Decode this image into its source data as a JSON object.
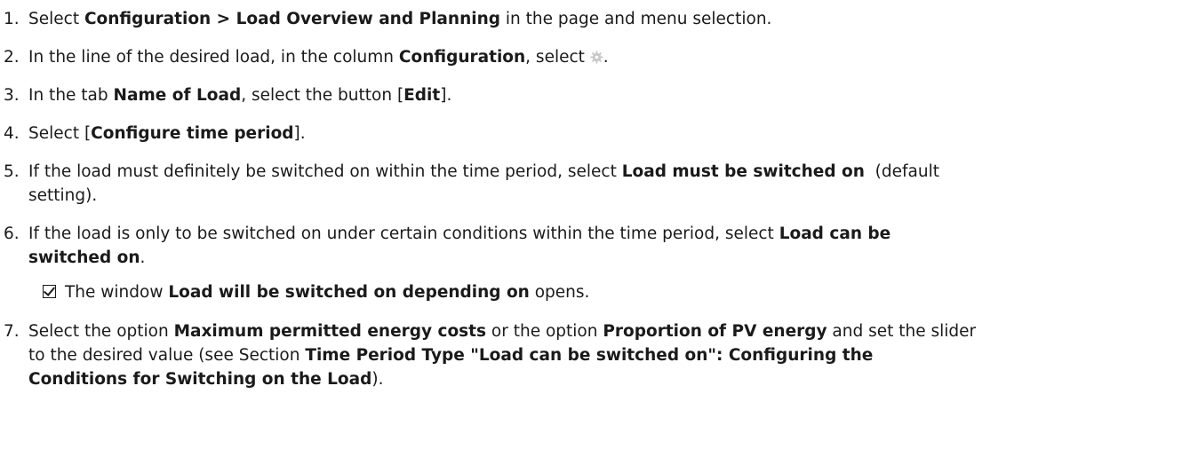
{
  "steps": [
    {
      "number": "1.",
      "parts": [
        "Select ",
        "Configuration > Load Overview and Planning",
        " in the page and menu selection."
      ]
    },
    {
      "number": "2.",
      "parts": [
        "In the line of the desired load, in the column ",
        "Configuration",
        ", select ",
        "."
      ],
      "icon": "gear-icon"
    },
    {
      "number": "3.",
      "parts": [
        "In the tab ",
        "Name of Load",
        ", select the button [",
        "Edit",
        "]."
      ]
    },
    {
      "number": "4.",
      "parts": [
        "Select [",
        "Configure time period",
        "]."
      ]
    },
    {
      "number": "5.",
      "line1": [
        "If the load must definitely be switched on within the time period, select ",
        "Load must be switched on",
        "  (default"
      ],
      "line2": "setting)."
    },
    {
      "number": "6.",
      "line1": [
        "If the load is only to be switched on under certain conditions within the time period, select ",
        "Load can be"
      ],
      "line2": "switched on",
      "line2_suffix": "."
    },
    {
      "number": "7.",
      "line1": [
        "Select the option ",
        "Maximum permitted energy costs",
        " or the option ",
        "Proportion of PV energy",
        " and set the slider"
      ],
      "line2": [
        "to the desired value (see Section ",
        "Time Period Type \"Load can be switched on\": Configuring the"
      ],
      "line3": [
        "Conditions for Switching on the Load",
        ")."
      ]
    }
  ],
  "result": {
    "icon": "checkbox-checked-icon",
    "parts": [
      "The window ",
      "Load will be switched on depending on",
      " opens."
    ]
  }
}
